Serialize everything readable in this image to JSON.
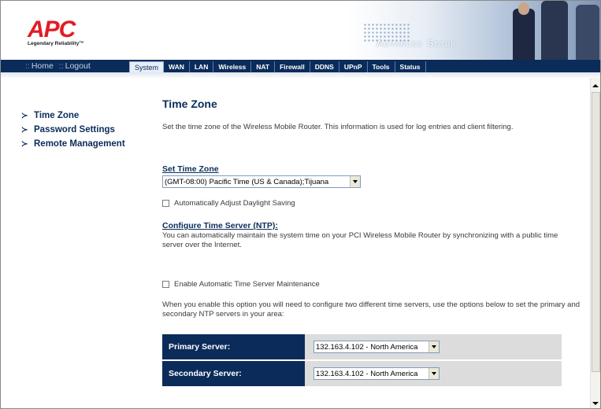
{
  "brand": {
    "logo_text": "APC",
    "tagline": "Legendary Reliability™",
    "banner_text": "Advanced Setup"
  },
  "nav": {
    "home_label": "Home",
    "logout_label": "Logout",
    "tabs": [
      {
        "label": "System",
        "active": true
      },
      {
        "label": "WAN"
      },
      {
        "label": "LAN"
      },
      {
        "label": "Wireless"
      },
      {
        "label": "NAT"
      },
      {
        "label": "Firewall"
      },
      {
        "label": "DDNS"
      },
      {
        "label": "UPnP"
      },
      {
        "label": "Tools"
      },
      {
        "label": "Status"
      }
    ]
  },
  "sidebar": {
    "items": [
      {
        "label": "Time Zone"
      },
      {
        "label": "Password Settings"
      },
      {
        "label": "Remote Management"
      }
    ]
  },
  "main": {
    "title": "Time Zone",
    "intro": "Set the time zone of the Wireless Mobile Router. This information is used for log entries and client filtering.",
    "set_tz_label": "Set Time Zone",
    "tz_value": "(GMT-08:00) Pacific Time (US & Canada);Tijuana",
    "dst_label": "Automatically Adjust Daylight Saving",
    "ntp_heading": "Configure Time Server (NTP):",
    "ntp_desc": "You can automatically maintain the system time on your PCI Wireless Mobile Router by synchronizing with a public time server over the Internet.",
    "enable_label": "Enable Automatic Time Server Maintenance",
    "enable_desc": "When you enable this option you will need to configure two different time servers, use the options below to set the primary and secondary NTP servers in your area:",
    "primary_label": "Primary Server:",
    "primary_value": "132.163.4.102 - North America",
    "secondary_label": "Secondary Server:",
    "secondary_value": "132.163.4.102 - North America"
  },
  "colors": {
    "brand_red": "#e31b23",
    "nav_blue": "#0b2c5a",
    "table_cell": "#dcdcdc"
  }
}
